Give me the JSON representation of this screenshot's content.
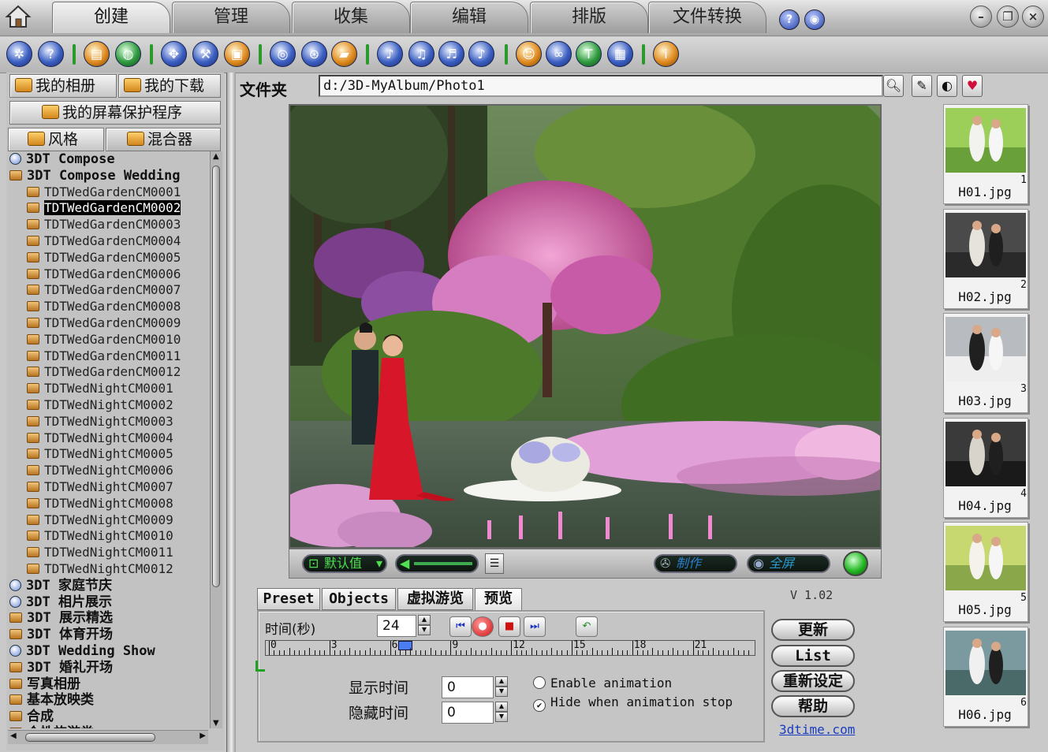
{
  "menu_tabs": [
    "创建",
    "管理",
    "收集",
    "编辑",
    "排版",
    "文件转换"
  ],
  "left_buttons": {
    "my_album": "我的相册",
    "my_download": "我的下载",
    "screensaver": "我的屏幕保护程序",
    "style": "风格",
    "mixer": "混合器"
  },
  "tree": {
    "items": [
      {
        "label": "3DT Compose",
        "level": 0,
        "icon": "clock-icon"
      },
      {
        "label": "3DT Compose Wedding",
        "level": 0,
        "icon": "folder-icon"
      },
      {
        "label": "TDTWedGardenCM0001",
        "level": 1
      },
      {
        "label": "TDTWedGardenCM0002",
        "level": 1,
        "selected": true
      },
      {
        "label": "TDTWedGardenCM0003",
        "level": 1
      },
      {
        "label": "TDTWedGardenCM0004",
        "level": 1
      },
      {
        "label": "TDTWedGardenCM0005",
        "level": 1
      },
      {
        "label": "TDTWedGardenCM0006",
        "level": 1
      },
      {
        "label": "TDTWedGardenCM0007",
        "level": 1
      },
      {
        "label": "TDTWedGardenCM0008",
        "level": 1
      },
      {
        "label": "TDTWedGardenCM0009",
        "level": 1
      },
      {
        "label": "TDTWedGardenCM0010",
        "level": 1
      },
      {
        "label": "TDTWedGardenCM0011",
        "level": 1
      },
      {
        "label": "TDTWedGardenCM0012",
        "level": 1
      },
      {
        "label": "TDTWedNightCM0001",
        "level": 1
      },
      {
        "label": "TDTWedNightCM0002",
        "level": 1
      },
      {
        "label": "TDTWedNightCM0003",
        "level": 1
      },
      {
        "label": "TDTWedNightCM0004",
        "level": 1
      },
      {
        "label": "TDTWedNightCM0005",
        "level": 1
      },
      {
        "label": "TDTWedNightCM0006",
        "level": 1
      },
      {
        "label": "TDTWedNightCM0007",
        "level": 1
      },
      {
        "label": "TDTWedNightCM0008",
        "level": 1
      },
      {
        "label": "TDTWedNightCM0009",
        "level": 1
      },
      {
        "label": "TDTWedNightCM0010",
        "level": 1
      },
      {
        "label": "TDTWedNightCM0011",
        "level": 1
      },
      {
        "label": "TDTWedNightCM0012",
        "level": 1
      },
      {
        "label": "3DT 家庭节庆",
        "level": 0,
        "icon": "clock-icon"
      },
      {
        "label": "3DT 相片展示",
        "level": 0,
        "icon": "clock-icon"
      },
      {
        "label": "3DT 展示精选",
        "level": 0,
        "icon": "folder-icon"
      },
      {
        "label": "3DT 体育开场",
        "level": 0,
        "icon": "folder-icon"
      },
      {
        "label": "3DT Wedding Show",
        "level": 0,
        "icon": "clock-icon"
      },
      {
        "label": "3DT 婚礼开场",
        "level": 0,
        "icon": "folder-icon"
      },
      {
        "label": "写真相册",
        "level": 0,
        "icon": "folder-icon"
      },
      {
        "label": "基本放映类",
        "level": 0,
        "icon": "folder-icon"
      },
      {
        "label": "合成",
        "level": 0,
        "icon": "folder-icon"
      },
      {
        "label": "个性旅游类",
        "level": 0,
        "icon": "folder-icon"
      }
    ]
  },
  "folder": {
    "label": "文件夹",
    "path": "d:/3D-MyAlbum/Photo1"
  },
  "preview_controls": {
    "default_value": "默认值",
    "make": "制作",
    "fullscreen": "全屏"
  },
  "bottom_tabs": [
    "Preset",
    "Objects",
    "虚拟游览",
    "预览"
  ],
  "version": "V 1.02",
  "timing": {
    "time_label": "时间(秒)",
    "time_value": "24",
    "show_label": "显示时间",
    "show_value": "0",
    "hide_label": "隐藏时间",
    "hide_value": "0"
  },
  "ruler_labels": [
    "0",
    "3",
    "6",
    "9",
    "12",
    "15",
    "18",
    "21"
  ],
  "options": {
    "enable_animation": "Enable animation",
    "hide_when_stop": "Hide when animation stop",
    "enable_checked": false,
    "hide_checked": true
  },
  "right_buttons": {
    "update": "更新",
    "list": "List",
    "reset": "重新设定",
    "help": "帮助",
    "link": "3dtime.com"
  },
  "thumbnails": [
    {
      "name": "H01.jpg",
      "num": "1"
    },
    {
      "name": "H02.jpg",
      "num": "2"
    },
    {
      "name": "H03.jpg",
      "num": "3"
    },
    {
      "name": "H04.jpg",
      "num": "4"
    },
    {
      "name": "H05.jpg",
      "num": "5"
    },
    {
      "name": "H06.jpg",
      "num": "6"
    }
  ],
  "colors": {
    "accent_green": "#4ee04e",
    "bride_red": "#d8162a",
    "blossom_pink": "#d96fb0"
  }
}
